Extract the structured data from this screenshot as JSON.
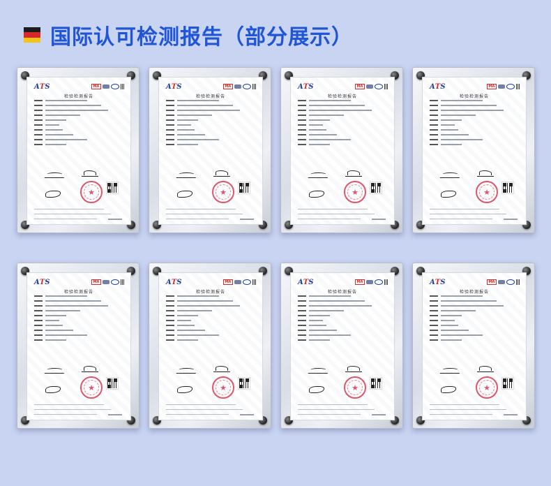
{
  "header": {
    "title": "国际认可检测报告（部分展示）",
    "flag_colors": [
      "#1c1c1c",
      "#d62a2a",
      "#f2c318"
    ]
  },
  "certificates": [
    {
      "logo_text": "ATS",
      "logo_marks": [
        "MA",
        "ilac-mra",
        "CNAS"
      ],
      "report_title": "检验检测报告"
    },
    {
      "logo_text": "ATS",
      "logo_marks": [
        "MA",
        "ilac-mra",
        "CNAS"
      ],
      "report_title": "检验检测报告"
    },
    {
      "logo_text": "ATS",
      "logo_marks": [
        "MA",
        "ilac-mra",
        "CNAS"
      ],
      "report_title": "检验检测报告"
    },
    {
      "logo_text": "ATS",
      "logo_marks": [
        "MA",
        "ilac-mra",
        "CNAS"
      ],
      "report_title": "检验检测报告"
    },
    {
      "logo_text": "ATS",
      "logo_marks": [
        "MA",
        "ilac-mra",
        "CNAS"
      ],
      "report_title": "检验检测报告"
    },
    {
      "logo_text": "ATS",
      "logo_marks": [
        "MA",
        "ilac-mra",
        "CNAS"
      ],
      "report_title": "检验检测报告"
    },
    {
      "logo_text": "ATS",
      "logo_marks": [
        "MA",
        "ilac-mra",
        "CNAS"
      ],
      "report_title": "检验检测报告"
    },
    {
      "logo_text": "ATS",
      "logo_marks": [
        "MA",
        "ilac-mra",
        "CNAS"
      ],
      "report_title": "检验检测报告"
    }
  ],
  "colors": {
    "background": "#c9d3f2",
    "title": "#1f55d6",
    "stamp": "#e0556b"
  }
}
